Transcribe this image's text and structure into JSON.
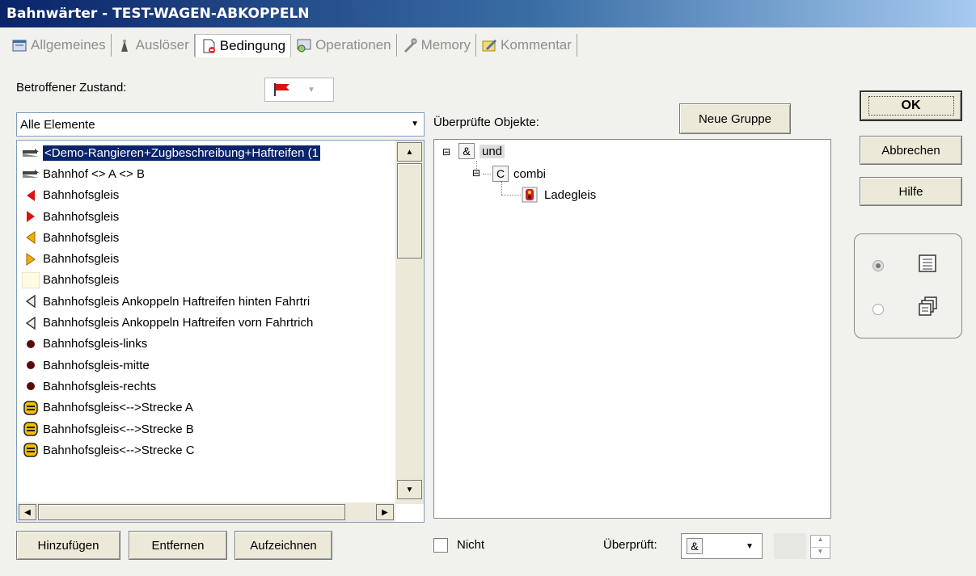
{
  "window": {
    "title": "Bahnwärter - TEST-WAGEN-ABKOPPELN"
  },
  "tabs": [
    {
      "label": "Allgemeines",
      "icon": "properties-icon"
    },
    {
      "label": "Auslöser",
      "icon": "trigger-icon"
    },
    {
      "label": "Bedingung",
      "icon": "condition-icon",
      "active": true
    },
    {
      "label": "Operationen",
      "icon": "operations-icon"
    },
    {
      "label": "Memory",
      "icon": "memory-icon"
    },
    {
      "label": "Kommentar",
      "icon": "comment-icon"
    }
  ],
  "left": {
    "zustand_label": "Betroffener Zustand:",
    "filter_value": "Alle Elemente",
    "items": [
      {
        "label": "<Demo-Rangieren+Zugbeschreibung+Haftreifen (1",
        "icon": "train-icon",
        "selected": true
      },
      {
        "label": "Bahnhof <> A <> B",
        "icon": "train-icon"
      },
      {
        "label": "Bahnhofsgleis",
        "icon": "red-triangle-left-icon"
      },
      {
        "label": "Bahnhofsgleis",
        "icon": "red-triangle-right-icon"
      },
      {
        "label": "Bahnhofsgleis",
        "icon": "yellow-triangle-left-icon"
      },
      {
        "label": "Bahnhofsgleis",
        "icon": "yellow-triangle-right-icon"
      },
      {
        "label": "Bahnhofsgleis",
        "icon": "blank-box-icon"
      },
      {
        "label": "Bahnhofsgleis  Ankoppeln Haftreifen hinten Fahrtri",
        "icon": "outline-triangle-left-icon"
      },
      {
        "label": "Bahnhofsgleis  Ankoppeln Haftreifen vorn Fahrtrich",
        "icon": "outline-triangle-left-icon"
      },
      {
        "label": "Bahnhofsgleis-links",
        "icon": "dot-icon"
      },
      {
        "label": "Bahnhofsgleis-mitte",
        "icon": "dot-icon"
      },
      {
        "label": "Bahnhofsgleis-rechts",
        "icon": "dot-icon"
      },
      {
        "label": "Bahnhofsgleis<-->Strecke A",
        "icon": "switch-icon"
      },
      {
        "label": "Bahnhofsgleis<-->Strecke B",
        "icon": "switch-icon"
      },
      {
        "label": "Bahnhofsgleis<-->Strecke C",
        "icon": "switch-icon"
      }
    ],
    "buttons": {
      "add": "Hinzufügen",
      "remove": "Entfernen",
      "record": "Aufzeichnen"
    }
  },
  "middle": {
    "checked_objects_label": "Überprüfte Objekte:",
    "new_group_button": "Neue Gruppe",
    "tree": {
      "root": {
        "symbol": "&",
        "label": "und"
      },
      "child": {
        "symbol": "C",
        "label": "combi"
      },
      "leaf": {
        "label": "Ladegleis",
        "icon": "signal-icon"
      }
    },
    "not_label": "Nicht",
    "checked_label": "Überprüft:",
    "checked_value": "&"
  },
  "right": {
    "ok": "OK",
    "cancel": "Abbrechen",
    "help": "Hilfe",
    "view_options": [
      "list-view-icon",
      "detail-view-icon"
    ]
  }
}
